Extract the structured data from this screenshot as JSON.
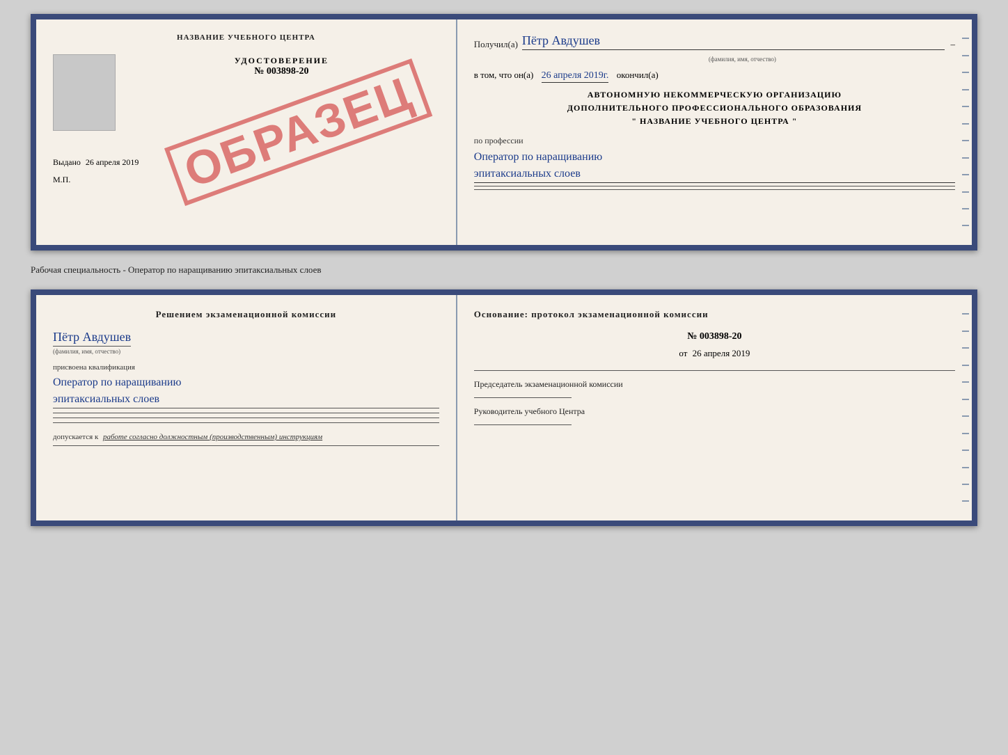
{
  "top_cert": {
    "left": {
      "title": "НАЗВАНИЕ УЧЕБНОГО ЦЕНТРА",
      "udostoverenie_label": "УДОСТОВЕРЕНИЕ",
      "number": "№ 003898-20",
      "vydano_label": "Выдано",
      "vydano_date": "26 апреля 2019",
      "mp": "М.П.",
      "obrazets": "ОБРАЗЕЦ"
    },
    "right": {
      "poluchil": "Получил(а)",
      "name": "Пётр Авдушев",
      "name_sub": "(фамилия, имя, отчество)",
      "dash": "–",
      "vtom": "в том, что он(а)",
      "date": "26 апреля 2019г.",
      "okonchil": "окончил(а)",
      "org_line1": "АВТОНОМНУЮ НЕКОММЕРЧЕСКУЮ ОРГАНИЗАЦИЮ",
      "org_line2": "ДОПОЛНИТЕЛЬНОГО ПРОФЕССИОНАЛЬНОГО ОБРАЗОВАНИЯ",
      "org_line3": "\"  НАЗВАНИЕ УЧЕБНОГО ЦЕНТРА  \"",
      "professii": "по профессии",
      "profession": "Оператор по наращиванию эпитаксиальных слоев"
    }
  },
  "separator": {
    "text": "Рабочая специальность - Оператор по наращиванию эпитаксиальных слоев"
  },
  "bottom_cert": {
    "left": {
      "heading": "Решением  экзаменационной  комиссии",
      "name": "Пётр Авдушев",
      "name_sub": "(фамилия, имя, отчество)",
      "prisvoena": "присвоена квалификация",
      "qualification": "Оператор по наращиванию эпитаксиальных слоев",
      "dopuskaetsya": "допускается к",
      "work_text": "работе согласно должностным (производственным) инструкциям"
    },
    "right": {
      "heading": "Основание:  протокол  экзаменационной  комиссии",
      "number": "№  003898-20",
      "date_prefix": "от",
      "date": "26 апреля 2019",
      "predsedatel_label": "Председатель экзаменационной комиссии",
      "rukovoditel_label": "Руководитель учебного Центра"
    }
  },
  "spine": {
    "lines_count": 12
  }
}
